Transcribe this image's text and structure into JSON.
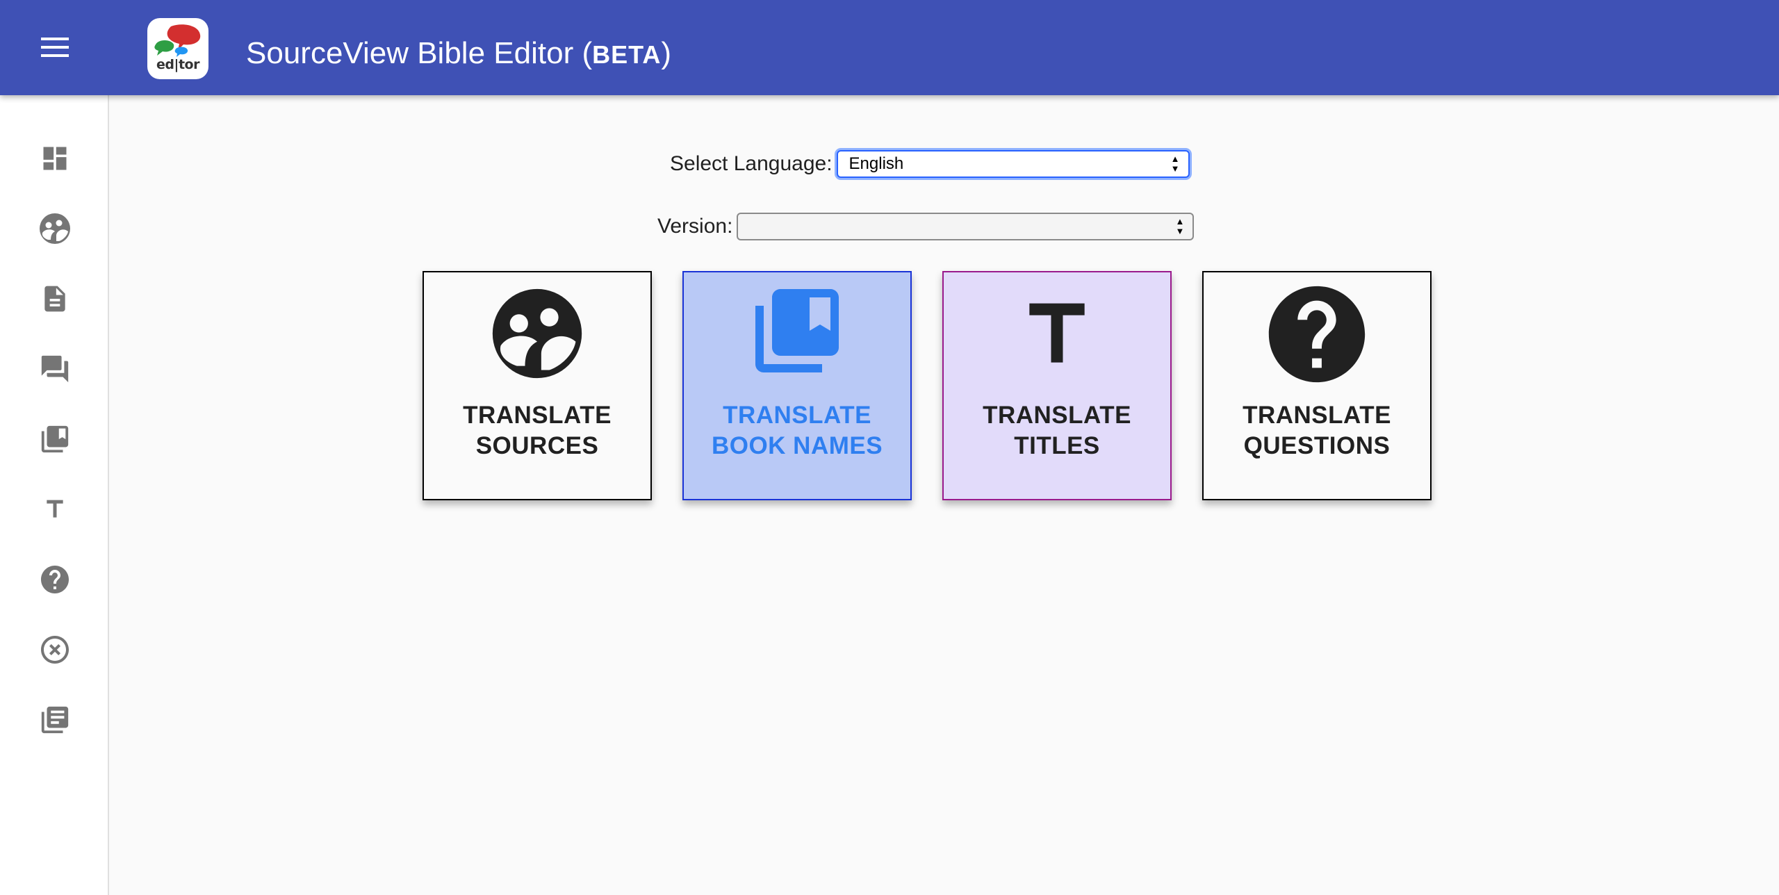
{
  "header": {
    "title": "SourceView Bible Editor (",
    "title_beta": "BETA",
    "title_close": ")",
    "logo_text": "ed|tor",
    "menu_icon": "menu-icon"
  },
  "sidebar": {
    "items": [
      {
        "icon": "dashboard-icon"
      },
      {
        "icon": "sources-icon"
      },
      {
        "icon": "document-icon"
      },
      {
        "icon": "questions-chat-icon"
      },
      {
        "icon": "library-books-icon"
      },
      {
        "icon": "title-text-icon"
      },
      {
        "icon": "help-icon"
      },
      {
        "icon": "cancel-icon"
      },
      {
        "icon": "article-list-icon"
      }
    ]
  },
  "form": {
    "language_label": "Select Language:",
    "language_value": "English",
    "version_label": "Version:",
    "version_value": ""
  },
  "cards": [
    {
      "line1": "TRANSLATE",
      "line2": "SOURCES",
      "icon": "sources-icon",
      "state": "default"
    },
    {
      "line1": "TRANSLATE",
      "line2": "BOOK NAMES",
      "icon": "library-books-icon",
      "state": "selected"
    },
    {
      "line1": "TRANSLATE",
      "line2": "TITLES",
      "icon": "title-text-icon",
      "state": "hover"
    },
    {
      "line1": "TRANSLATE",
      "line2": "QUESTIONS",
      "icon": "help-icon",
      "state": "default"
    }
  ],
  "colors": {
    "appbar": "#3f51b5",
    "selected_card_bg": "#b9c9f6",
    "selected_card_text": "#2f7ff0",
    "hover_card_bg": "#e2dbfa"
  }
}
